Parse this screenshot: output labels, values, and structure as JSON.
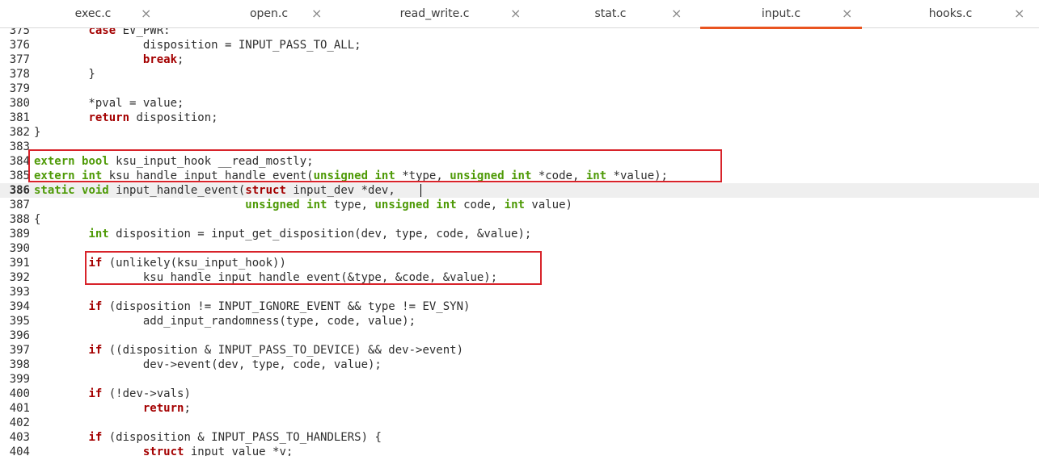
{
  "tabs": [
    {
      "label": "exec.c",
      "active": false
    },
    {
      "label": "open.c",
      "active": false
    },
    {
      "label": "read_write.c",
      "active": false
    },
    {
      "label": "stat.c",
      "active": false
    },
    {
      "label": "input.c",
      "active": true
    },
    {
      "label": "hooks.c",
      "active": false
    }
  ],
  "close_glyph": "×",
  "colors": {
    "accent": "#e95420",
    "keyword_red": "#a40000",
    "keyword_green": "#4e9a06",
    "highlight_box": "#d8232a"
  },
  "current_line": "386",
  "lines": [
    {
      "n": "375",
      "segs": [
        {
          "t": "        "
        },
        {
          "t": "case",
          "c": "r"
        },
        {
          "t": " EV_PWR:"
        }
      ]
    },
    {
      "n": "376",
      "segs": [
        {
          "t": "                disposition = INPUT_PASS_TO_ALL;"
        }
      ]
    },
    {
      "n": "377",
      "segs": [
        {
          "t": "                "
        },
        {
          "t": "break",
          "c": "r"
        },
        {
          "t": ";"
        }
      ]
    },
    {
      "n": "378",
      "segs": [
        {
          "t": "        }"
        }
      ]
    },
    {
      "n": "379",
      "segs": []
    },
    {
      "n": "380",
      "segs": [
        {
          "t": "        *pval = value;"
        }
      ]
    },
    {
      "n": "381",
      "segs": [
        {
          "t": "        "
        },
        {
          "t": "return",
          "c": "r"
        },
        {
          "t": " disposition;"
        }
      ]
    },
    {
      "n": "382",
      "segs": [
        {
          "t": "}"
        }
      ]
    },
    {
      "n": "383",
      "segs": []
    },
    {
      "n": "384",
      "segs": [
        {
          "t": "extern",
          "c": "g"
        },
        {
          "t": " "
        },
        {
          "t": "bool",
          "c": "g"
        },
        {
          "t": " ksu_input_hook __read_mostly;"
        }
      ]
    },
    {
      "n": "385",
      "segs": [
        {
          "t": "extern",
          "c": "g"
        },
        {
          "t": " "
        },
        {
          "t": "int",
          "c": "g"
        },
        {
          "t": " ksu_handle_input_handle_event("
        },
        {
          "t": "unsigned",
          "c": "g"
        },
        {
          "t": " "
        },
        {
          "t": "int",
          "c": "g"
        },
        {
          "t": " *type, "
        },
        {
          "t": "unsigned",
          "c": "g"
        },
        {
          "t": " "
        },
        {
          "t": "int",
          "c": "g"
        },
        {
          "t": " *code, "
        },
        {
          "t": "int",
          "c": "g"
        },
        {
          "t": " *value);"
        }
      ]
    },
    {
      "n": "386",
      "segs": [
        {
          "t": "static",
          "c": "g"
        },
        {
          "t": " "
        },
        {
          "t": "void",
          "c": "g"
        },
        {
          "t": " input_handle_event("
        },
        {
          "t": "struct",
          "c": "r"
        },
        {
          "t": " input_dev *dev,"
        }
      ]
    },
    {
      "n": "387",
      "segs": [
        {
          "t": "                               "
        },
        {
          "t": "unsigned",
          "c": "g"
        },
        {
          "t": " "
        },
        {
          "t": "int",
          "c": "g"
        },
        {
          "t": " type, "
        },
        {
          "t": "unsigned",
          "c": "g"
        },
        {
          "t": " "
        },
        {
          "t": "int",
          "c": "g"
        },
        {
          "t": " code, "
        },
        {
          "t": "int",
          "c": "g"
        },
        {
          "t": " value)"
        }
      ]
    },
    {
      "n": "388",
      "segs": [
        {
          "t": "{"
        }
      ]
    },
    {
      "n": "389",
      "segs": [
        {
          "t": "        "
        },
        {
          "t": "int",
          "c": "g"
        },
        {
          "t": " disposition = input_get_disposition(dev, type, code, &value);"
        }
      ]
    },
    {
      "n": "390",
      "segs": []
    },
    {
      "n": "391",
      "segs": [
        {
          "t": "        "
        },
        {
          "t": "if",
          "c": "r"
        },
        {
          "t": " (unlikely(ksu_input_hook))"
        }
      ]
    },
    {
      "n": "392",
      "segs": [
        {
          "t": "                ksu_handle_input_handle_event(&type, &code, &value);"
        }
      ]
    },
    {
      "n": "393",
      "segs": []
    },
    {
      "n": "394",
      "segs": [
        {
          "t": "        "
        },
        {
          "t": "if",
          "c": "r"
        },
        {
          "t": " (disposition != INPUT_IGNORE_EVENT && type != EV_SYN)"
        }
      ]
    },
    {
      "n": "395",
      "segs": [
        {
          "t": "                add_input_randomness(type, code, value);"
        }
      ]
    },
    {
      "n": "396",
      "segs": []
    },
    {
      "n": "397",
      "segs": [
        {
          "t": "        "
        },
        {
          "t": "if",
          "c": "r"
        },
        {
          "t": " ((disposition & INPUT_PASS_TO_DEVICE) && dev->event)"
        }
      ]
    },
    {
      "n": "398",
      "segs": [
        {
          "t": "                dev->event(dev, type, code, value);"
        }
      ]
    },
    {
      "n": "399",
      "segs": []
    },
    {
      "n": "400",
      "segs": [
        {
          "t": "        "
        },
        {
          "t": "if",
          "c": "r"
        },
        {
          "t": " (!dev->vals)"
        }
      ]
    },
    {
      "n": "401",
      "segs": [
        {
          "t": "                "
        },
        {
          "t": "return",
          "c": "r"
        },
        {
          "t": ";"
        }
      ]
    },
    {
      "n": "402",
      "segs": []
    },
    {
      "n": "403",
      "segs": [
        {
          "t": "        "
        },
        {
          "t": "if",
          "c": "r"
        },
        {
          "t": " (disposition & INPUT_PASS_TO_HANDLERS) {"
        }
      ]
    },
    {
      "n": "404",
      "segs": [
        {
          "t": "                "
        },
        {
          "t": "struct",
          "c": "r"
        },
        {
          "t": " input_value *v;"
        }
      ]
    }
  ]
}
